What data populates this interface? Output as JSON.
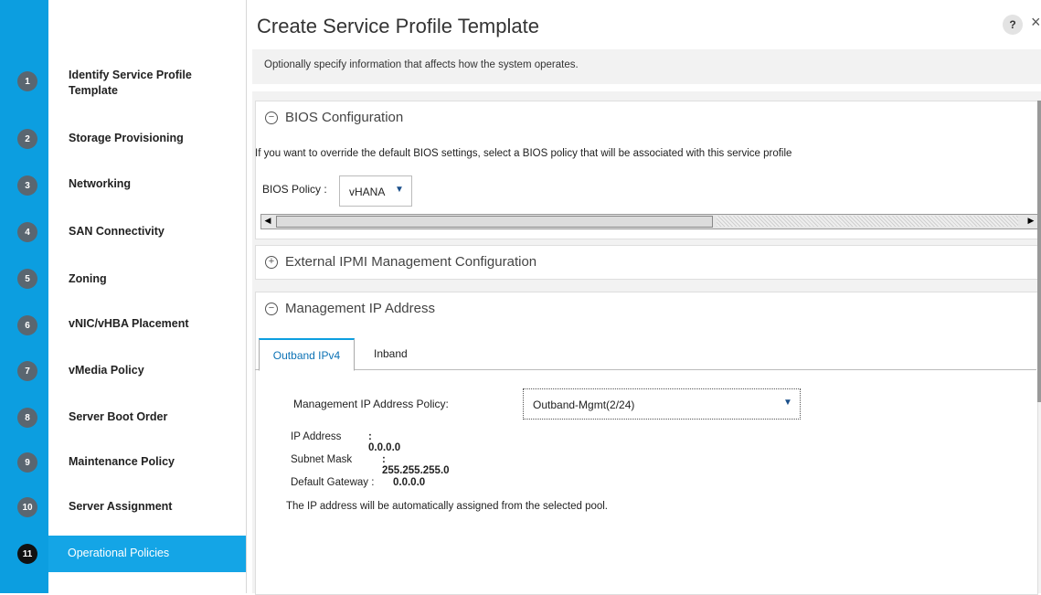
{
  "title": "Create Service Profile Template",
  "description": "Optionally specify information that affects how the system operates.",
  "steps": [
    {
      "num": "1",
      "label": "Identify Service Profile Template"
    },
    {
      "num": "2",
      "label": "Storage Provisioning"
    },
    {
      "num": "3",
      "label": "Networking"
    },
    {
      "num": "4",
      "label": "SAN Connectivity"
    },
    {
      "num": "5",
      "label": "Zoning"
    },
    {
      "num": "6",
      "label": "vNIC/vHBA Placement"
    },
    {
      "num": "7",
      "label": "vMedia Policy"
    },
    {
      "num": "8",
      "label": "Server Boot Order"
    },
    {
      "num": "9",
      "label": "Maintenance Policy"
    },
    {
      "num": "10",
      "label": "Server Assignment"
    },
    {
      "num": "11",
      "label": "Operational Policies"
    }
  ],
  "bios": {
    "heading": "BIOS Configuration",
    "text": "If you want to override the default BIOS settings, select a BIOS policy that will be associated with this service profile",
    "policy_label": "BIOS Policy :",
    "policy_value": "vHANA"
  },
  "ipmi": {
    "heading": "External IPMI Management Configuration"
  },
  "mgmt": {
    "heading": "Management IP Address",
    "tabs": [
      "Outband IPv4",
      "Inband"
    ],
    "policy_label": "Management IP Address Policy:",
    "policy_value": "Outband-Mgmt(2/24)",
    "ip_label": "IP Address",
    "ip_value": ": 0.0.0.0",
    "subnet_label": "Subnet Mask",
    "subnet_value": ": 255.255.255.0",
    "gateway_label": "Default Gateway :",
    "gateway_value": "0.0.0.0",
    "note": "The IP address will be automatically assigned from the selected pool."
  },
  "icons": {
    "help": "?",
    "close": "×",
    "collapse": "−",
    "expand": "+",
    "dropdown": "▼",
    "left": "◀",
    "right": "▶"
  },
  "colors": {
    "accent": "#0c9ee0",
    "active_step": "#14a5e6"
  }
}
